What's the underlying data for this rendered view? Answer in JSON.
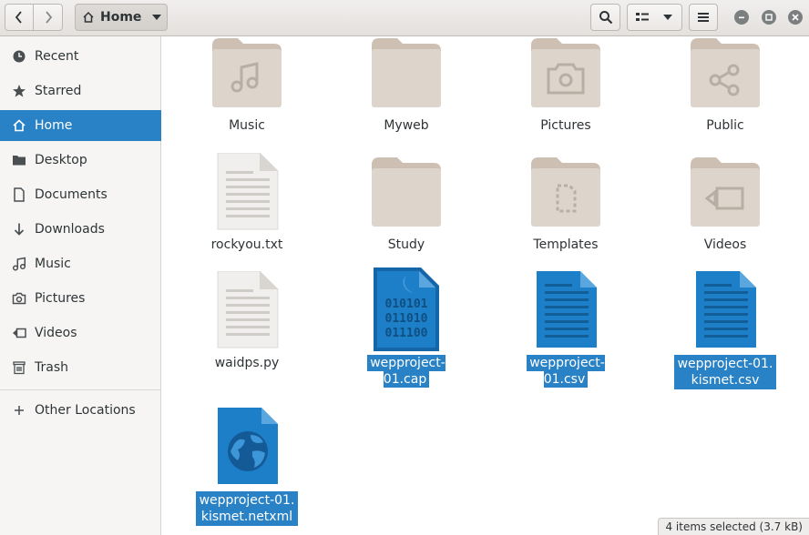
{
  "toolbar": {
    "back_icon": "chevron-left-icon",
    "forward_icon": "chevron-right-icon",
    "path_label": "Home",
    "search_icon": "search-icon",
    "view_icon": "list-view-icon",
    "menu_icon": "hamburger-menu-icon"
  },
  "sidebar": {
    "items": [
      {
        "label": "Recent",
        "icon": "clock-icon"
      },
      {
        "label": "Starred",
        "icon": "star-icon"
      },
      {
        "label": "Home",
        "icon": "home-icon",
        "active": true
      },
      {
        "label": "Desktop",
        "icon": "folder-icon"
      },
      {
        "label": "Documents",
        "icon": "document-icon"
      },
      {
        "label": "Downloads",
        "icon": "download-icon"
      },
      {
        "label": "Music",
        "icon": "music-icon"
      },
      {
        "label": "Pictures",
        "icon": "camera-icon"
      },
      {
        "label": "Videos",
        "icon": "video-icon"
      },
      {
        "label": "Trash",
        "icon": "trash-icon"
      },
      {
        "label": "Other Locations",
        "icon": "plus-icon"
      }
    ]
  },
  "files": [
    {
      "name": "Music",
      "type": "folder-music"
    },
    {
      "name": "Myweb",
      "type": "folder"
    },
    {
      "name": "Pictures",
      "type": "folder-pictures"
    },
    {
      "name": "Public",
      "type": "folder-public"
    },
    {
      "name": "rockyou.txt",
      "type": "text"
    },
    {
      "name": "Study",
      "type": "folder"
    },
    {
      "name": "Templates",
      "type": "folder-templates"
    },
    {
      "name": "Videos",
      "type": "folder-videos"
    },
    {
      "name": "waidps.py",
      "type": "text"
    },
    {
      "name": "wepproject-01.cap",
      "type": "binary",
      "selected": true
    },
    {
      "name": "wepproject-01.csv",
      "type": "spreadsheet",
      "selected": true
    },
    {
      "name_line1": "wepproject-01.",
      "name_line2": "kismet.csv",
      "type": "spreadsheet",
      "selected": true
    },
    {
      "name_line1": "wepproject-01.",
      "name_line2": "kismet.netxml",
      "type": "web",
      "selected": true
    }
  ],
  "binary_text": [
    "010101",
    "011010",
    "011100"
  ],
  "status": "4 items selected  (3.7 kB)",
  "colors": {
    "accent": "#2a82c6",
    "folder": "#ddd5cc",
    "folder_tab": "#cdbfb2",
    "doc_blue": "#1d7fc8"
  }
}
